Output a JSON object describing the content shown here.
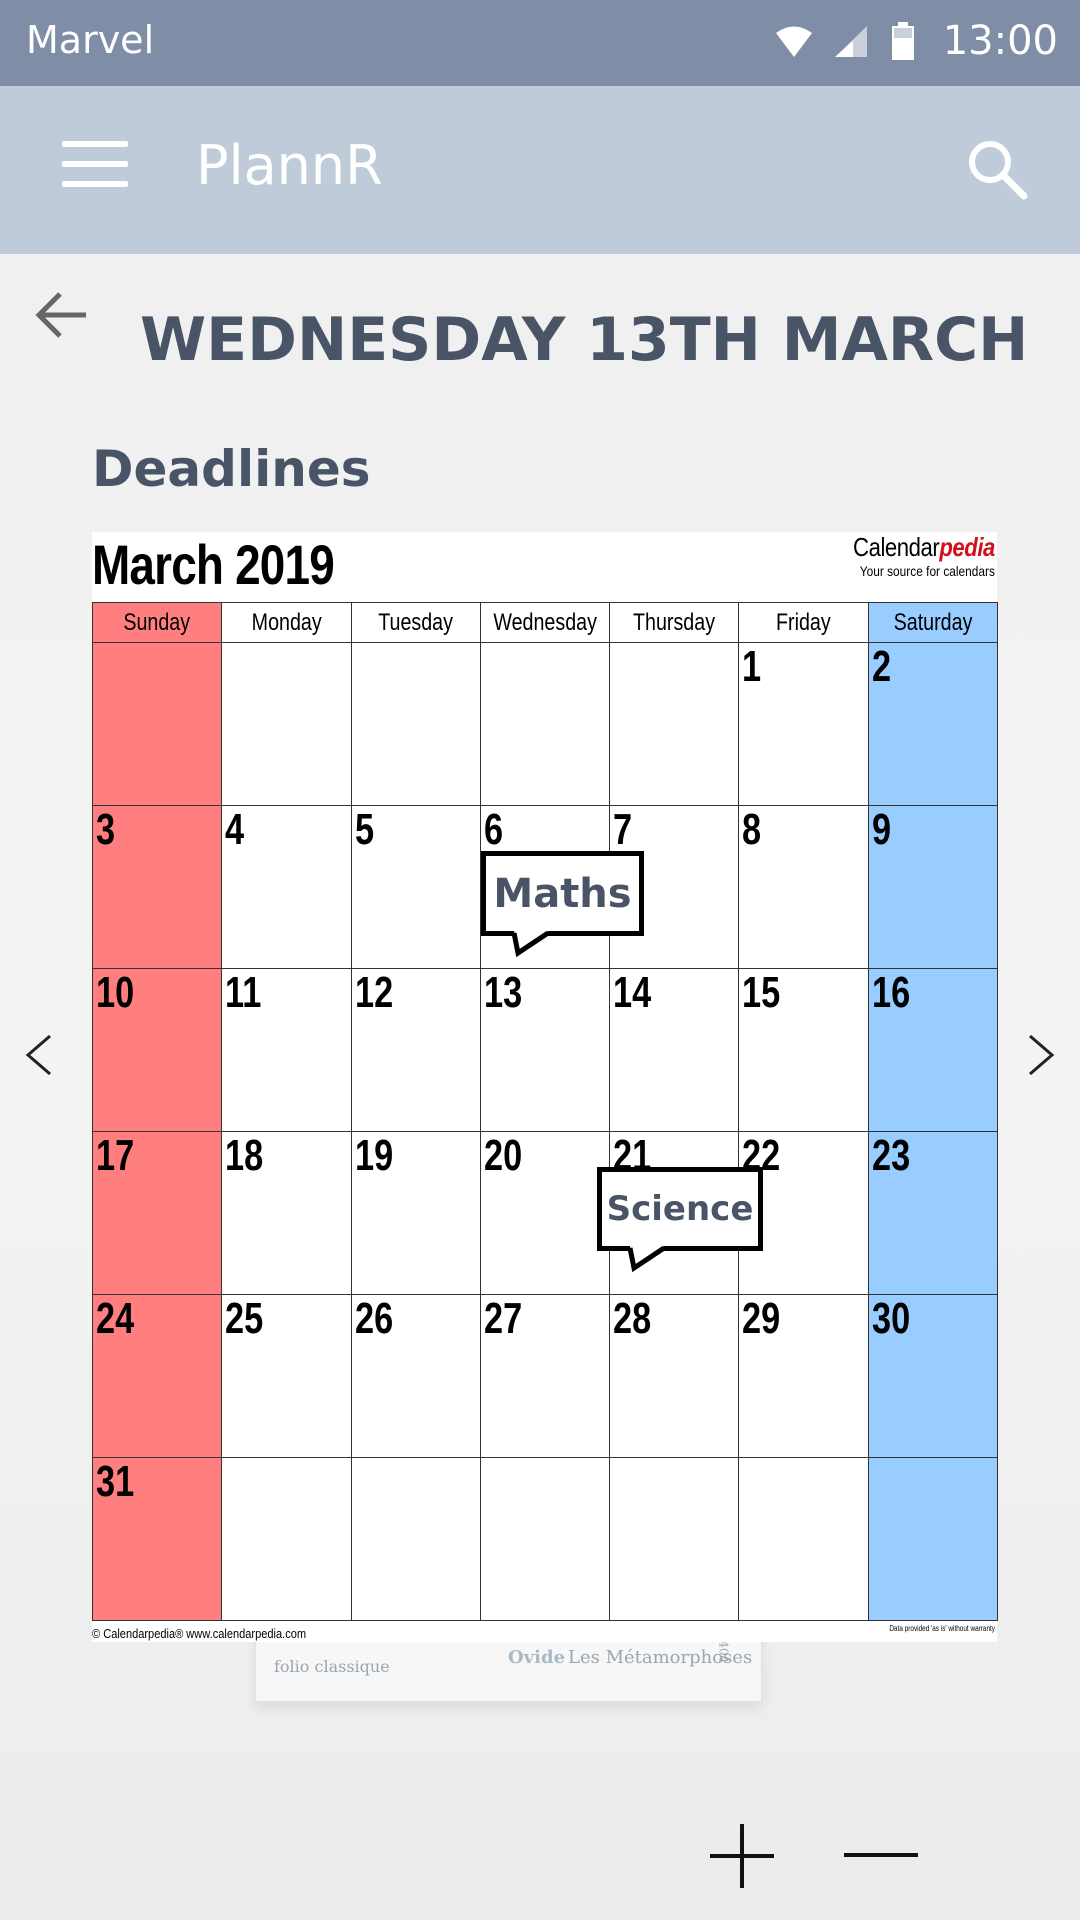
{
  "status_bar": {
    "carrier": "Marvel",
    "time": "13:00",
    "icons": [
      "wifi-icon",
      "signal-icon",
      "battery-icon"
    ],
    "background": "#7f8ea6"
  },
  "app_bar": {
    "title": "PlannR",
    "menu_icon": "hamburger-menu-icon",
    "search_icon": "search-icon",
    "background": "#c0cbd9"
  },
  "page": {
    "back_icon": "arrow-left-icon",
    "title": "WEDNESDAY 13TH MARCH",
    "section_title": "Deadlines",
    "text_color": "#495566"
  },
  "calendar": {
    "title": "March 2019",
    "brand_plain": "Calendar",
    "brand_accent": "pedia",
    "brand_tagline": "Your source for calendars",
    "weekdays": [
      "Sunday",
      "Monday",
      "Tuesday",
      "Wednesday",
      "Thursday",
      "Friday",
      "Saturday"
    ],
    "weeks": [
      [
        "",
        "",
        "",
        "",
        "",
        "1",
        "2"
      ],
      [
        "3",
        "4",
        "5",
        "6",
        "7",
        "8",
        "9"
      ],
      [
        "10",
        "11",
        "12",
        "13",
        "14",
        "15",
        "16"
      ],
      [
        "17",
        "18",
        "19",
        "20",
        "21",
        "22",
        "23"
      ],
      [
        "24",
        "25",
        "26",
        "27",
        "28",
        "29",
        "30"
      ],
      [
        "31",
        "",
        "",
        "",
        "",
        "",
        ""
      ]
    ],
    "footer_left": "© Calendarpedia®   www.calendarpedia.com",
    "footer_right": "Data provided 'as is' without warranty",
    "sunday_color": "#ff7f7f",
    "saturday_color": "#99ccff"
  },
  "deadlines": [
    {
      "label": "Maths"
    },
    {
      "label": "Science"
    }
  ],
  "book": {
    "left_text": "folio classique",
    "author": "Ovide",
    "work": "Les Métamorphoses",
    "number": "2404"
  },
  "navigation": {
    "prev_icon": "chevron-left-icon",
    "next_icon": "chevron-right-icon"
  },
  "zoom": {
    "in_icon": "plus-icon",
    "out_icon": "minus-icon"
  }
}
